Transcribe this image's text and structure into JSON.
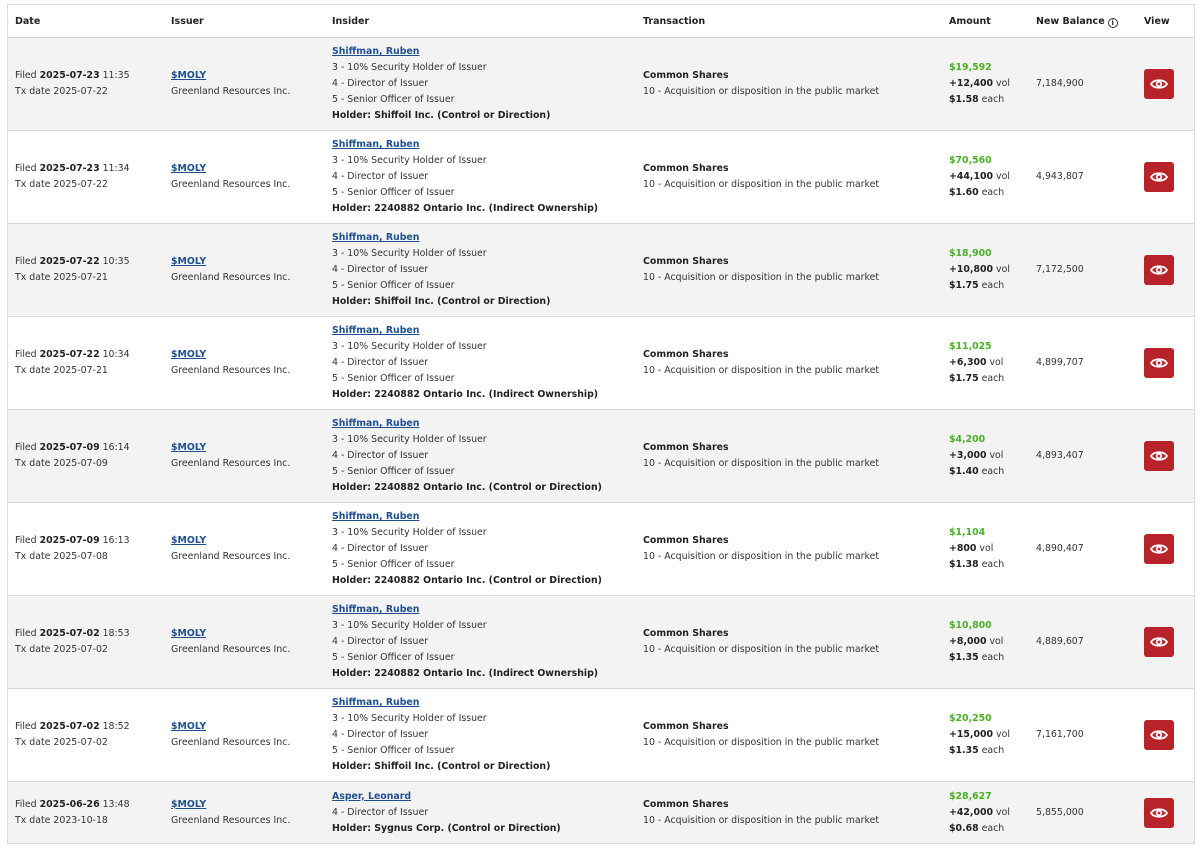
{
  "headers": {
    "date": "Date",
    "issuer": "Issuer",
    "insider": "Insider",
    "transaction": "Transaction",
    "amount": "Amount",
    "new_balance": "New Balance",
    "view": "View"
  },
  "labels": {
    "filed": "Filed",
    "tx_date": "Tx date",
    "vol": "vol",
    "each": "each"
  },
  "colors": {
    "accent": "#b8232a",
    "positive": "#4caf26",
    "link": "#1f4f8f"
  },
  "rows": [
    {
      "filed_date": "2025-07-23",
      "filed_time": "11:35",
      "tx_date": "2025-07-22",
      "ticker": "$MOLY",
      "issuer": "Greenland Resources Inc.",
      "insider": "Shiffman, Ruben",
      "roles": [
        "3 - 10% Security Holder of Issuer",
        "4 - Director of Issuer",
        "5 - Senior Officer of Issuer"
      ],
      "holder": "Holder: Shiffoil Inc. (Control or Direction)",
      "security": "Common Shares",
      "nature": "10 - Acquisition or disposition in the public market",
      "amount": "$19,592",
      "volume": "+12,400",
      "price": "$1.58",
      "balance": "7,184,900"
    },
    {
      "filed_date": "2025-07-23",
      "filed_time": "11:34",
      "tx_date": "2025-07-22",
      "ticker": "$MOLY",
      "issuer": "Greenland Resources Inc.",
      "insider": "Shiffman, Ruben",
      "roles": [
        "3 - 10% Security Holder of Issuer",
        "4 - Director of Issuer",
        "5 - Senior Officer of Issuer"
      ],
      "holder": "Holder: 2240882 Ontario Inc. (Indirect Ownership)",
      "security": "Common Shares",
      "nature": "10 - Acquisition or disposition in the public market",
      "amount": "$70,560",
      "volume": "+44,100",
      "price": "$1.60",
      "balance": "4,943,807"
    },
    {
      "filed_date": "2025-07-22",
      "filed_time": "10:35",
      "tx_date": "2025-07-21",
      "ticker": "$MOLY",
      "issuer": "Greenland Resources Inc.",
      "insider": "Shiffman, Ruben",
      "roles": [
        "3 - 10% Security Holder of Issuer",
        "4 - Director of Issuer",
        "5 - Senior Officer of Issuer"
      ],
      "holder": "Holder: Shiffoil Inc. (Control or Direction)",
      "security": "Common Shares",
      "nature": "10 - Acquisition or disposition in the public market",
      "amount": "$18,900",
      "volume": "+10,800",
      "price": "$1.75",
      "balance": "7,172,500"
    },
    {
      "filed_date": "2025-07-22",
      "filed_time": "10:34",
      "tx_date": "2025-07-21",
      "ticker": "$MOLY",
      "issuer": "Greenland Resources Inc.",
      "insider": "Shiffman, Ruben",
      "roles": [
        "3 - 10% Security Holder of Issuer",
        "4 - Director of Issuer",
        "5 - Senior Officer of Issuer"
      ],
      "holder": "Holder: 2240882 Ontario Inc. (Indirect Ownership)",
      "security": "Common Shares",
      "nature": "10 - Acquisition or disposition in the public market",
      "amount": "$11,025",
      "volume": "+6,300",
      "price": "$1.75",
      "balance": "4,899,707"
    },
    {
      "filed_date": "2025-07-09",
      "filed_time": "16:14",
      "tx_date": "2025-07-09",
      "ticker": "$MOLY",
      "issuer": "Greenland Resources Inc.",
      "insider": "Shiffman, Ruben",
      "roles": [
        "3 - 10% Security Holder of Issuer",
        "4 - Director of Issuer",
        "5 - Senior Officer of Issuer"
      ],
      "holder": "Holder: 2240882 Ontario Inc. (Control or Direction)",
      "security": "Common Shares",
      "nature": "10 - Acquisition or disposition in the public market",
      "amount": "$4,200",
      "volume": "+3,000",
      "price": "$1.40",
      "balance": "4,893,407"
    },
    {
      "filed_date": "2025-07-09",
      "filed_time": "16:13",
      "tx_date": "2025-07-08",
      "ticker": "$MOLY",
      "issuer": "Greenland Resources Inc.",
      "insider": "Shiffman, Ruben",
      "roles": [
        "3 - 10% Security Holder of Issuer",
        "4 - Director of Issuer",
        "5 - Senior Officer of Issuer"
      ],
      "holder": "Holder: 2240882 Ontario Inc. (Control or Direction)",
      "security": "Common Shares",
      "nature": "10 - Acquisition or disposition in the public market",
      "amount": "$1,104",
      "volume": "+800",
      "price": "$1.38",
      "balance": "4,890,407"
    },
    {
      "filed_date": "2025-07-02",
      "filed_time": "18:53",
      "tx_date": "2025-07-02",
      "ticker": "$MOLY",
      "issuer": "Greenland Resources Inc.",
      "insider": "Shiffman, Ruben",
      "roles": [
        "3 - 10% Security Holder of Issuer",
        "4 - Director of Issuer",
        "5 - Senior Officer of Issuer"
      ],
      "holder": "Holder: 2240882 Ontario Inc. (Indirect Ownership)",
      "security": "Common Shares",
      "nature": "10 - Acquisition or disposition in the public market",
      "amount": "$10,800",
      "volume": "+8,000",
      "price": "$1.35",
      "balance": "4,889,607"
    },
    {
      "filed_date": "2025-07-02",
      "filed_time": "18:52",
      "tx_date": "2025-07-02",
      "ticker": "$MOLY",
      "issuer": "Greenland Resources Inc.",
      "insider": "Shiffman, Ruben",
      "roles": [
        "3 - 10% Security Holder of Issuer",
        "4 - Director of Issuer",
        "5 - Senior Officer of Issuer"
      ],
      "holder": "Holder: Shiffoil Inc. (Control or Direction)",
      "security": "Common Shares",
      "nature": "10 - Acquisition or disposition in the public market",
      "amount": "$20,250",
      "volume": "+15,000",
      "price": "$1.35",
      "balance": "7,161,700"
    },
    {
      "filed_date": "2025-06-26",
      "filed_time": "13:48",
      "tx_date": "2023-10-18",
      "ticker": "$MOLY",
      "issuer": "Greenland Resources Inc.",
      "insider": "Asper, Leonard",
      "roles": [
        "4 - Director of Issuer"
      ],
      "holder": "Holder: Sygnus Corp. (Control or Direction)",
      "security": "Common Shares",
      "nature": "10 - Acquisition or disposition in the public market",
      "amount": "$28,627",
      "volume": "+42,000",
      "price": "$0.68",
      "balance": "5,855,000"
    }
  ]
}
